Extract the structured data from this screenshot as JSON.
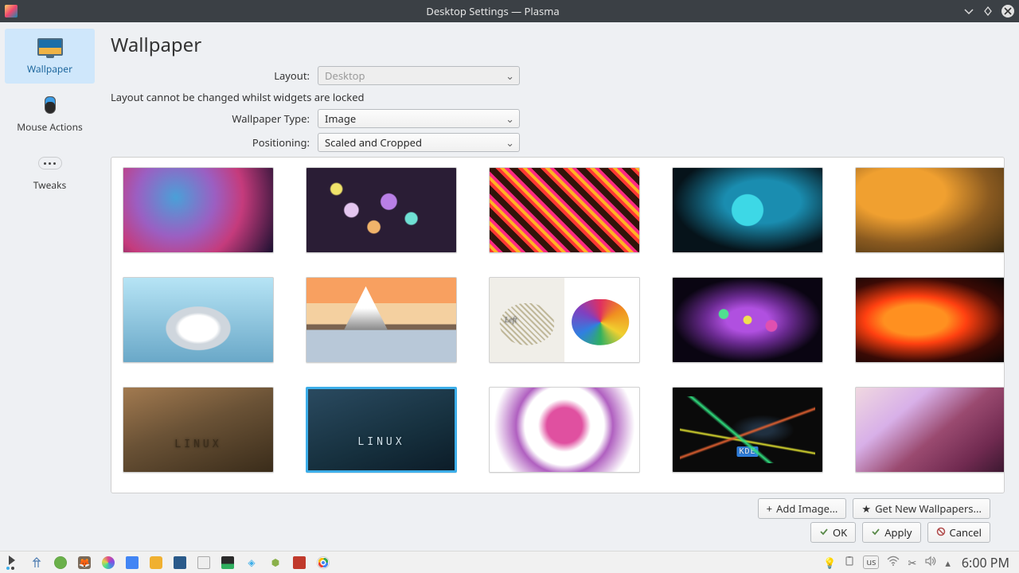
{
  "window": {
    "title": "Desktop Settings — Plasma"
  },
  "sidebar": {
    "items": [
      {
        "label": "Wallpaper",
        "icon": "monitor-icon",
        "active": true
      },
      {
        "label": "Mouse Actions",
        "icon": "mouse-icon",
        "active": false
      },
      {
        "label": "Tweaks",
        "icon": "more-icon",
        "active": false
      }
    ]
  },
  "page": {
    "title": "Wallpaper",
    "layout_label": "Layout:",
    "layout_value": "Desktop",
    "layout_note": "Layout cannot be changed whilst widgets are locked",
    "type_label": "Wallpaper Type:",
    "type_value": "Image",
    "positioning_label": "Positioning:",
    "positioning_value": "Scaled and Cropped"
  },
  "wallpapers": {
    "items": [
      {
        "name": "wp-1"
      },
      {
        "name": "wp-2"
      },
      {
        "name": "wp-3"
      },
      {
        "name": "wp-4"
      },
      {
        "name": "wp-5"
      },
      {
        "name": "wp-6"
      },
      {
        "name": "wp-7"
      },
      {
        "name": "wp-8"
      },
      {
        "name": "wp-9"
      },
      {
        "name": "wp-10"
      },
      {
        "name": "wp-11",
        "caption": "LINUX"
      },
      {
        "name": "wp-12",
        "caption": "LINUX",
        "selected": true
      },
      {
        "name": "wp-13"
      },
      {
        "name": "wp-14",
        "caption": "KDE"
      },
      {
        "name": "wp-15"
      }
    ]
  },
  "toolbar": {
    "add_image": "Add Image...",
    "get_new": "Get New Wallpapers..."
  },
  "dialog": {
    "ok": "OK",
    "apply": "Apply",
    "cancel": "Cancel"
  },
  "taskbar": {
    "kbd_layout": "us",
    "clock": "6:00 PM"
  }
}
